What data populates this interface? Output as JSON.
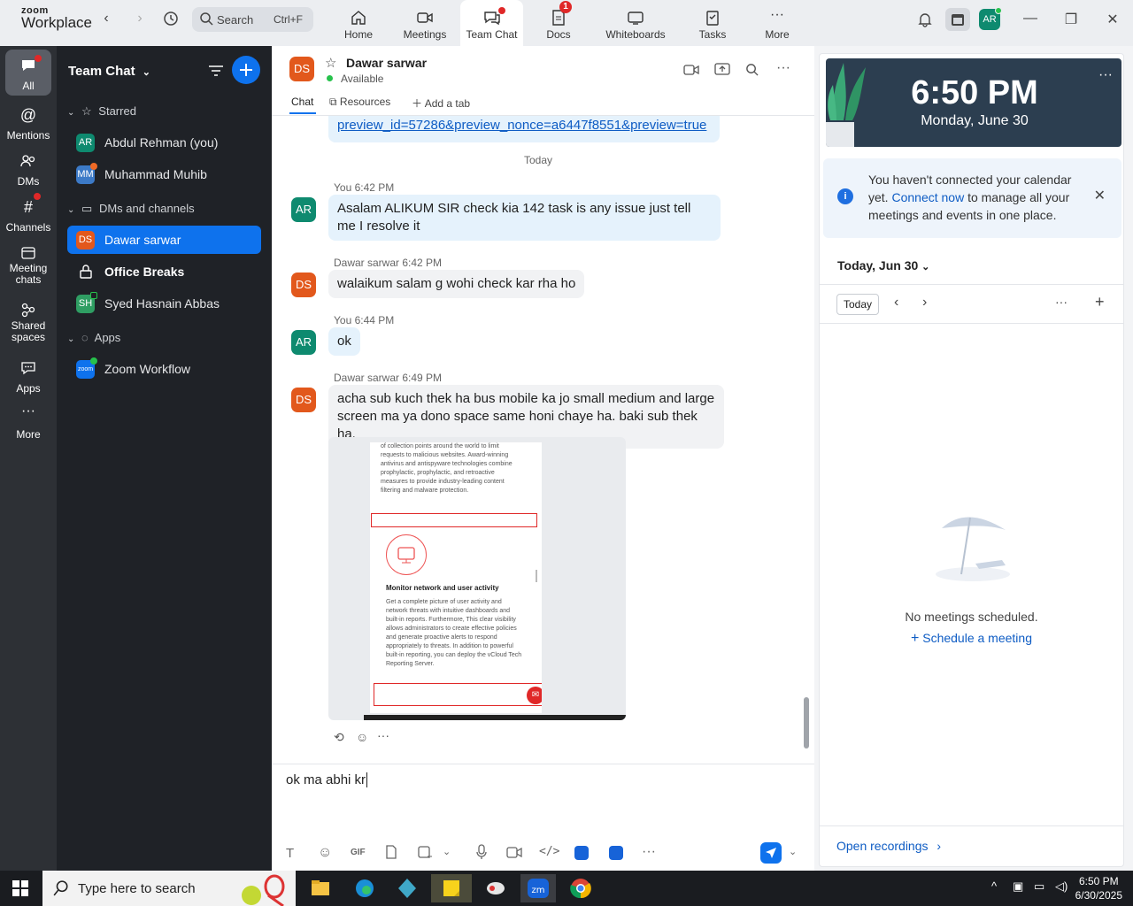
{
  "app": {
    "logo_small": "zoom",
    "logo_big": "Workplace"
  },
  "search": {
    "label": "Search",
    "shortcut": "Ctrl+F"
  },
  "nav_tabs": [
    {
      "label": "Home",
      "icon": "home-icon"
    },
    {
      "label": "Meetings",
      "icon": "video-camera-icon"
    },
    {
      "label": "Team Chat",
      "icon": "chat-bubbles-icon",
      "active": true
    },
    {
      "label": "Docs",
      "icon": "docs-icon",
      "badge": "1"
    },
    {
      "label": "Whiteboards",
      "icon": "whiteboard-icon"
    },
    {
      "label": "Tasks",
      "icon": "tasks-icon"
    },
    {
      "label": "More",
      "icon": "more-dots-icon"
    }
  ],
  "user_avatar": "AR",
  "rail": [
    {
      "label": "All",
      "icon": "chat-bubble-icon",
      "active": true
    },
    {
      "label": "Mentions",
      "icon": "at-icon"
    },
    {
      "label": "DMs",
      "icon": "people-icon"
    },
    {
      "label": "Channels",
      "icon": "hash-icon"
    },
    {
      "label": "Meeting chats",
      "icon": "calendar-chat-icon"
    },
    {
      "label": "Shared spaces",
      "icon": "shared-spaces-icon"
    },
    {
      "label": "Apps",
      "icon": "apps-icon"
    },
    {
      "label": "More",
      "icon": "more-dots-icon"
    }
  ],
  "sidebar": {
    "title": "Team Chat",
    "sections": {
      "starred": "Starred",
      "dms": "DMs and channels",
      "apps": "Apps"
    },
    "starred_items": [
      {
        "initials": "AR",
        "name": "Abdul Rehman (you)"
      },
      {
        "initials": "MM",
        "name": "Muhammad Muhib"
      }
    ],
    "dm_items": [
      {
        "initials": "DS",
        "name": "Dawar sarwar",
        "active": true
      },
      {
        "initials": "",
        "name": "Office Breaks",
        "bold": true
      },
      {
        "initials": "SH",
        "name": "Syed Hasnain Abbas"
      }
    ],
    "app_items": [
      {
        "initials": "zoom",
        "name": "Zoom Workflow"
      }
    ]
  },
  "chat": {
    "contact_initials": "DS",
    "contact_name": "Dawar sarwar",
    "contact_status": "Available",
    "tabs": {
      "chat": "Chat",
      "resources": "Resources",
      "add": "Add a tab"
    },
    "prev_link": "preview_id=57286&preview_nonce=a6447f8551&preview=true",
    "date_divider": "Today",
    "messages": [
      {
        "author": "You",
        "time": "6:42 PM",
        "initials": "AR",
        "text": "Asalam ALIKUM SIR  check kia 142 task is any issue just tell me I resolve it"
      },
      {
        "author": "Dawar sarwar",
        "time": "6:42 PM",
        "initials": "DS",
        "text": "walaikum salam g wohi check kar rha ho"
      },
      {
        "author": "You",
        "time": "6:44 PM",
        "initials": "AR",
        "text": "ok"
      },
      {
        "author": "Dawar sarwar",
        "time": "6:49 PM",
        "initials": "DS",
        "text": "acha sub kuch thek ha bus mobile ka jo small medium and large screen ma ya dono space same honi chaye ha. baki sub thek ha,"
      }
    ],
    "attachment": {
      "text_top": "of collection points around the world to limit requests to malicious websites. Award-winning antivirus and antispyware technologies combine prophylactic, prophylactic, and retroactive measures to provide industry-leading content filtering and malware protection.",
      "heading": "Monitor network and user activity",
      "text_body": "Get a complete picture of user activity and network threats with intuitive dashboards and built-in reports. Furthermore, This clear visibility allows administrators to create effective policies and generate proactive alerts to respond appropriately to threats. In addition to powerful built-in reporting, you can deploy the vCloud Tech Reporting Server."
    },
    "composer_text": "ok ma abhi kr"
  },
  "right_panel": {
    "time": "6:50 PM",
    "date": "Monday, June 30",
    "calendar_notice_pre": "You haven't connected your calendar yet.",
    "calendar_notice_link": "Connect now",
    "calendar_notice_post": "to manage all your meetings and events in one place.",
    "day_label": "Today, Jun 30",
    "today_btn": "Today",
    "empty_text": "No meetings scheduled.",
    "schedule_link": "Schedule a meeting",
    "open_recordings": "Open recordings"
  },
  "taskbar": {
    "search_placeholder": "Type here to search",
    "time": "6:50 PM",
    "date": "6/30/2025"
  },
  "colors": {
    "accent": "#0e72ed",
    "rail_bg": "#2d3035",
    "sidebar_bg": "#1f2227",
    "badge_red": "#e02828"
  }
}
